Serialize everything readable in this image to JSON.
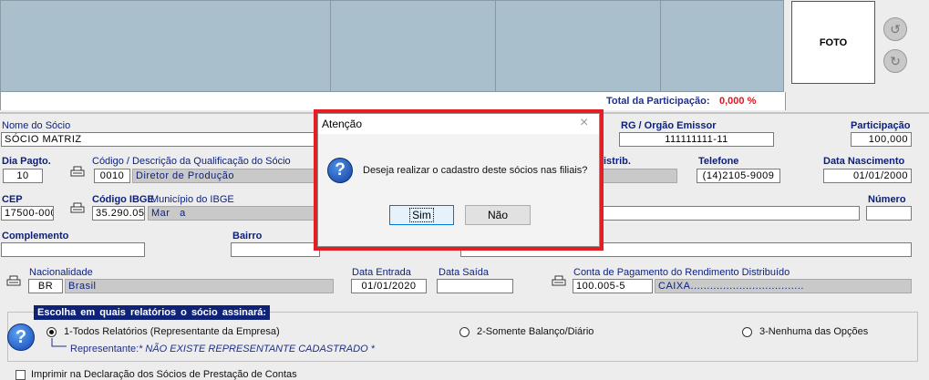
{
  "grid": {
    "total_label": "Total da Participação:",
    "total_value": "0,000 %"
  },
  "photo": {
    "label": "FOTO"
  },
  "form": {
    "nome_socio": {
      "label": "Nome do Sócio",
      "value": "SÓCIO MATRIZ"
    },
    "rg": {
      "label": "RG / Orgão Emissor",
      "value": "111111111-11"
    },
    "participacao": {
      "label": "Participação",
      "value": "100,000"
    },
    "dia_pagto": {
      "label": "Dia Pagto.",
      "value": "10"
    },
    "codigo_qualificacao": {
      "label": "Código  /  Descrição da Qualificação do Sócio",
      "code": "0010",
      "desc": "Diretor de Produção"
    },
    "distrib_partial": "istrib.",
    "telefone": {
      "label": "Telefone",
      "value": "(14)2105-9009"
    },
    "data_nascimento": {
      "label": "Data Nascimento",
      "value": "01/01/2000"
    },
    "cep": {
      "label": "CEP",
      "value": "17500-000"
    },
    "codigo_ibge": {
      "label": "Código IBGE",
      "value": "35.290.05"
    },
    "municipio_ibge": {
      "label": "Município do IBGE",
      "value": "Mar   a"
    },
    "numero": {
      "label": "Número",
      "value": ""
    },
    "complemento": {
      "label": "Complemento",
      "value": ""
    },
    "bairro": {
      "label": "Bairro",
      "value": ""
    },
    "nacionalidade": {
      "label": "Nacionalidade",
      "code": "BR",
      "desc": "Brasil"
    },
    "data_entrada": {
      "label": "Data Entrada",
      "value": "01/01/2020"
    },
    "data_saida": {
      "label": "Data Saída",
      "value": ""
    },
    "conta_pagamento": {
      "label": "Conta de Pagamento do Rendimento Distribuído",
      "code": "100.005-5",
      "desc": "CAIXA..................................."
    }
  },
  "assinatura": {
    "title": "Escolha em quais relatórios o sócio assinará:",
    "options": [
      {
        "label": "1-Todos Relatórios (Representante da Empresa)",
        "selected": true
      },
      {
        "label": "2-Somente Balanço/Diário",
        "selected": false
      },
      {
        "label": "3-Nenhuma das Opções",
        "selected": false
      }
    ],
    "representante_label": "Representante:",
    "representante_value": "* NÃO EXISTE REPRESENTANTE CADASTRADO *"
  },
  "bottom_checkbox": {
    "label": "Imprimir na Declaração dos Sócios de Prestação de Contas"
  },
  "dialog": {
    "title": "Atenção",
    "message": "Deseja realizar o cadastro deste sócios nas filiais?",
    "yes_label": "Sim",
    "no_label": "Não"
  },
  "colors": {
    "highlight": "#e51d24",
    "label_blue": "#0b1f7a",
    "total_red": "#e8121c"
  }
}
